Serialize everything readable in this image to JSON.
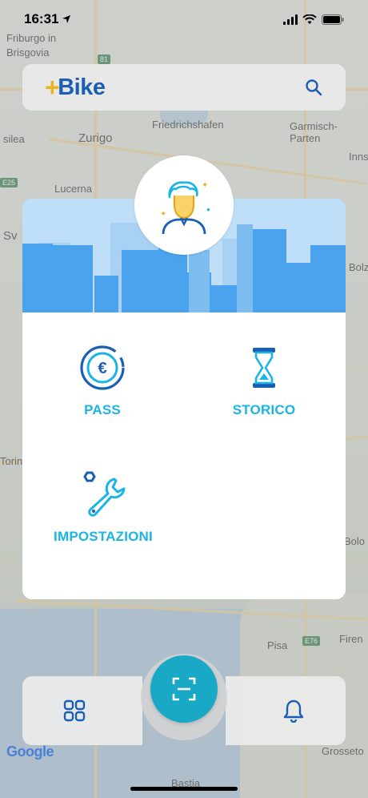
{
  "status_bar": {
    "time": "16:31"
  },
  "app": {
    "logo_plus": "+",
    "logo_text": "Bike"
  },
  "map": {
    "places": [
      "Friburgo in",
      "Brisgovia",
      "Zurigo",
      "Friedrichshafen",
      "Garmisch-Parten",
      "Lucerna",
      "Innsb",
      "Sv",
      "Bolz",
      "Torin",
      "Bolo",
      "Pisa",
      "Firen",
      "Grosseto",
      "Bastia",
      "silea"
    ],
    "shields": [
      "81",
      "E25",
      "E76"
    ],
    "attribution": "Google"
  },
  "menu": {
    "items": [
      {
        "label": "PASS",
        "icon": "euro-coin-icon"
      },
      {
        "label": "STORICO",
        "icon": "hourglass-icon"
      },
      {
        "label": "IMPOSTAZIONI",
        "icon": "wrench-icon"
      }
    ]
  },
  "colors": {
    "accent": "#1ab4e6",
    "brand": "#1b5fb4",
    "logo_plus": "#e8b423",
    "scan": "#1aa8c7",
    "banner": "#bcdcf7"
  }
}
